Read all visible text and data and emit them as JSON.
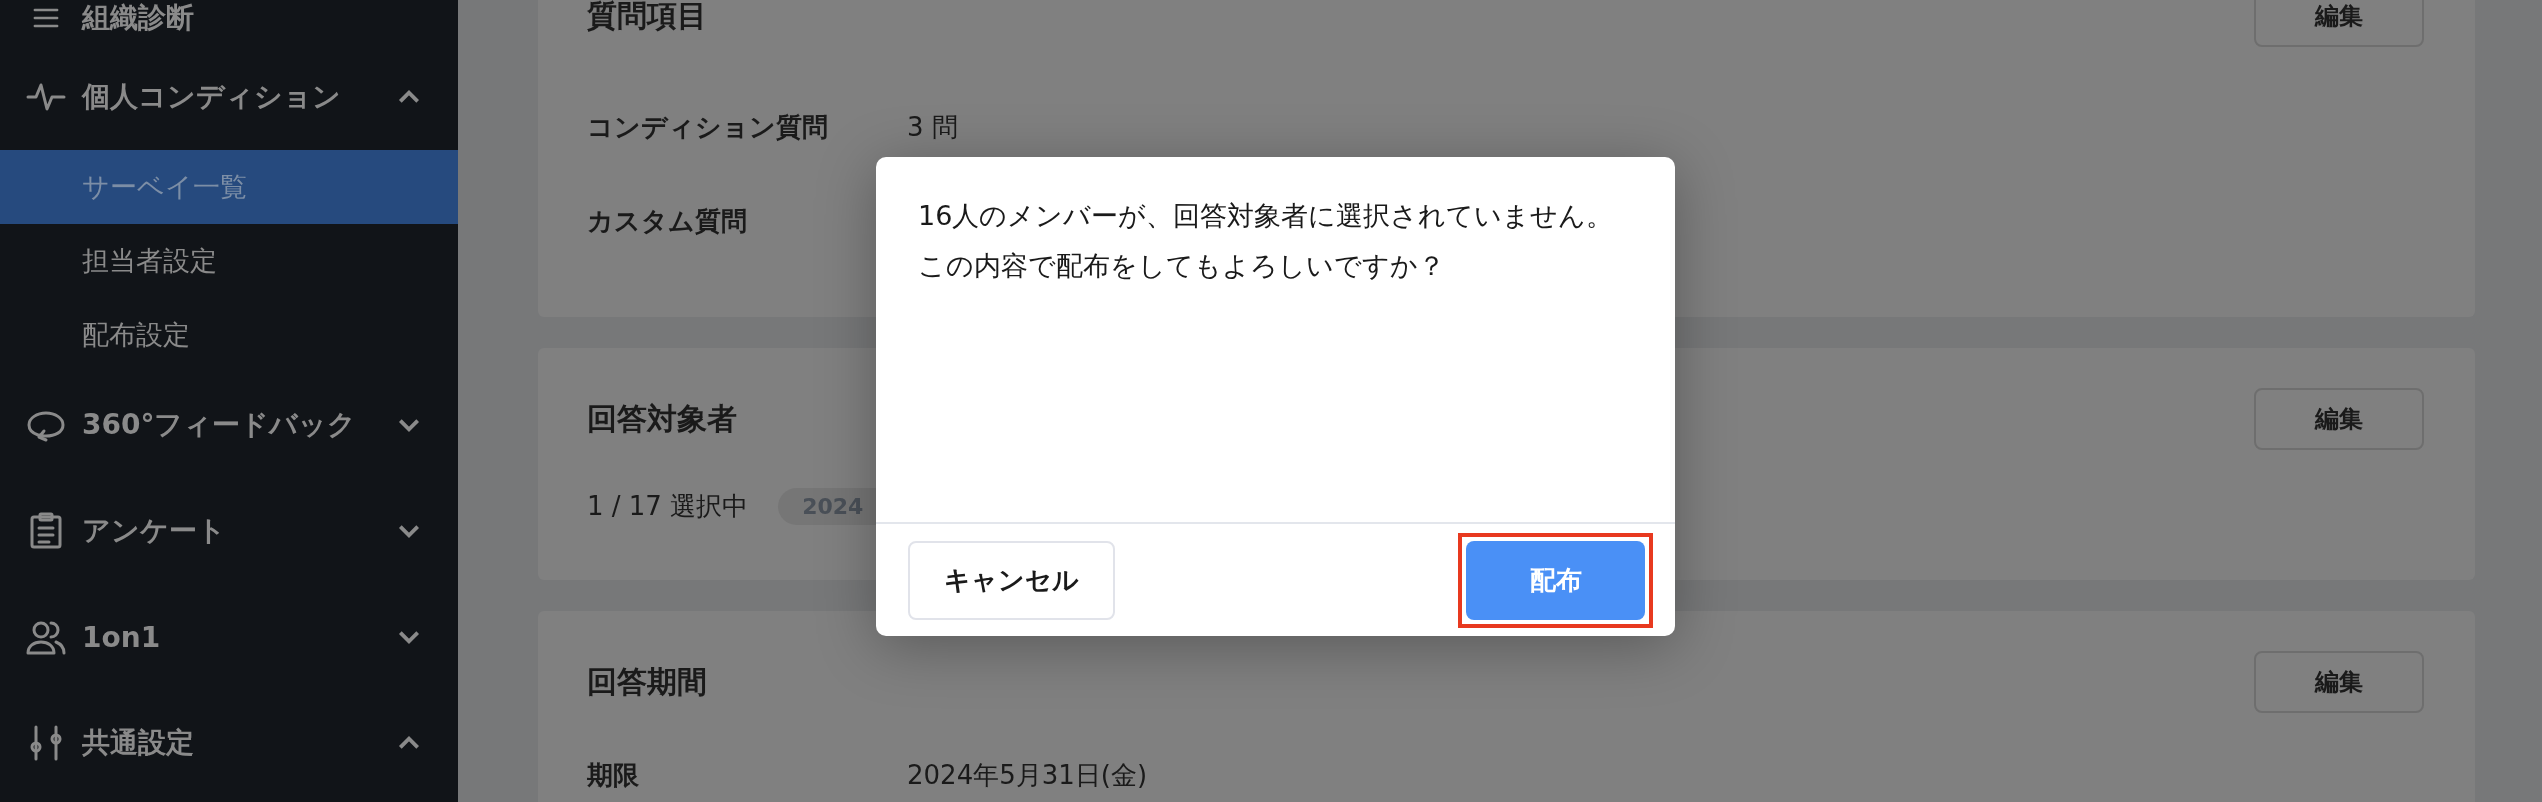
{
  "sidebar": {
    "items": [
      {
        "label": "組織診断"
      },
      {
        "label": "個人コンディション",
        "expanded": true,
        "children": [
          {
            "label": "サーベイ一覧",
            "selected": true
          },
          {
            "label": "担当者設定",
            "selected": false
          },
          {
            "label": "配布設定",
            "selected": false
          }
        ]
      },
      {
        "label": "360°フィードバック",
        "expanded": false
      },
      {
        "label": "アンケート",
        "expanded": false
      },
      {
        "label": "1on1",
        "expanded": false
      },
      {
        "label": "共通設定",
        "expanded": true
      }
    ]
  },
  "sections": [
    {
      "title": "質問項目",
      "edit_button": "編集",
      "rows": [
        {
          "label": "コンディション質問",
          "value": "3 問"
        },
        {
          "label": "カスタム質問"
        }
      ]
    },
    {
      "title": "回答対象者",
      "edit_button": "編集",
      "summary": "1 / 17 選択中",
      "chip": "2024"
    },
    {
      "title": "回答期間",
      "edit_button": "編集",
      "rows": [
        {
          "label": "期限",
          "value": "2024年5月31日(金)"
        }
      ]
    }
  ],
  "dialog": {
    "message": [
      "16人のメンバーが、回答対象者に選択されていません。",
      "この内容で配布をしてもよろしいですか？"
    ],
    "cancel_button": "キャンセル",
    "confirm_button": "配布",
    "confirm_highlighted": true
  }
}
